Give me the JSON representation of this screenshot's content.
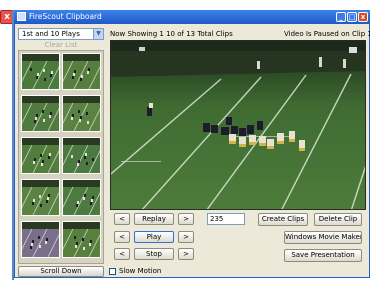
{
  "window": {
    "title": "FireScout Clipboard",
    "close_glyph": "x",
    "minimize_glyph": "_",
    "maximize_glyph": "□",
    "close_button_glyph": "x"
  },
  "sidebar": {
    "play_filter": {
      "selected": "1st and 10 Plays",
      "arrow": "▼"
    },
    "clear_list_label": "Clear List",
    "scroll_down_label": "Scroll Down",
    "thumbnails": [
      {
        "field_color": "#4c7a3c"
      },
      {
        "field_color": "#557e3f"
      },
      {
        "field_color": "#4f7c3e"
      },
      {
        "field_color": "#5a8242"
      },
      {
        "field_color": "#527d3d"
      },
      {
        "field_color": "#4a7a40"
      },
      {
        "field_color": "#5b8443"
      },
      {
        "field_color": "#4d7b3f"
      },
      {
        "field_color": "#7a6f8a"
      },
      {
        "field_color": "#57803f"
      }
    ]
  },
  "status": {
    "clip_count": "Now Showing 1 10 of 13 Total Clips",
    "video_state": "Video Is Paused on Clip 1"
  },
  "video": {
    "field_color": "#3f6b32",
    "sky_color": "#1b2a1a",
    "team_a_color": "#e8e2d0",
    "team_b_color": "#1c1c2c"
  },
  "controls": {
    "replay": {
      "prev": "<",
      "label": "Replay",
      "next": ">"
    },
    "play": {
      "prev": "<",
      "label": "Play",
      "next": ">"
    },
    "stop": {
      "prev": "<",
      "label": "Stop",
      "next": ">"
    },
    "frame_value": "235",
    "create_clips_label": "Create Clips",
    "delete_clip_label": "Delete Clip",
    "movie_maker_label": "Windows Movie Maker",
    "save_presentation_label": "Save Presentation",
    "slow_motion_label": "Slow Motion"
  }
}
